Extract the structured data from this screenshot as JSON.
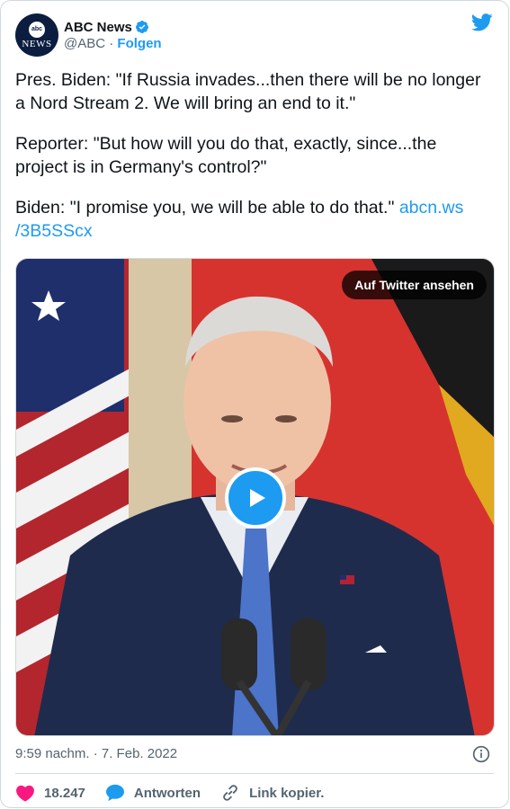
{
  "account": {
    "name": "ABC News",
    "handle": "@ABC",
    "separator": "·",
    "follow_label": "Folgen",
    "avatar_top": "abc",
    "avatar_bottom": "NEWS"
  },
  "tweet": {
    "para1": "Pres. Biden: \"If Russia invades...then there will be no longer a Nord Stream 2. We will bring an end to it.\"",
    "para2": "Reporter: \"But how will you do that, exactly, since...the project is in Germany's control?\"",
    "para3": "Biden: \"I promise you, we will be able to do that.\" ",
    "link": "abcn.ws /3B5SScx"
  },
  "media": {
    "watch_label": "Auf Twitter ansehen"
  },
  "meta": {
    "timestamp": "9:59 nachm. · 7. Feb. 2022"
  },
  "actions": {
    "likes": "18.247",
    "reply_label": "Antworten",
    "copy_link_label": "Link kopier."
  },
  "colors": {
    "accent": "#1d9bf0",
    "like": "#f91880",
    "text": "#0f1419",
    "muted": "#536471"
  }
}
